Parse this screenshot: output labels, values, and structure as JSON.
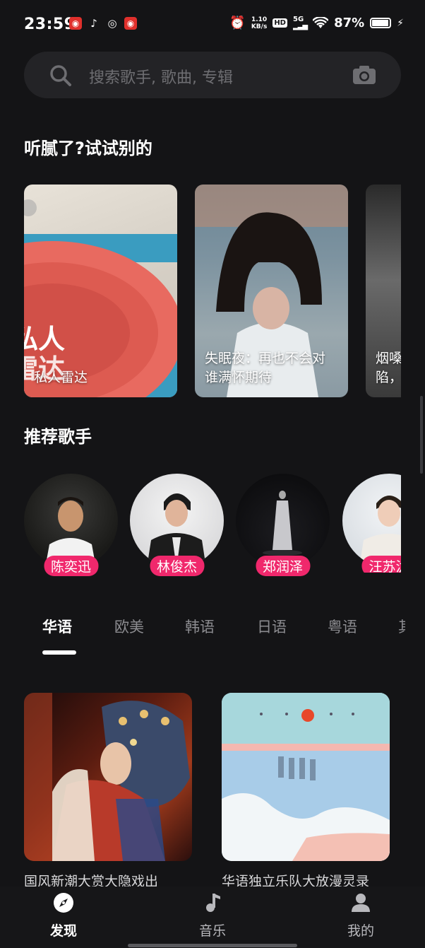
{
  "status_bar": {
    "time": "23:59",
    "net_speed_value": "1.10",
    "net_speed_unit": "KB/s",
    "hd": "HD",
    "network": "5G",
    "battery": "87%",
    "battery_level": 0.87
  },
  "search": {
    "placeholder": "搜索歌手, 歌曲, 专辑"
  },
  "section_try_others": {
    "title": "听腻了?试试别的",
    "cards": [
      {
        "overlay_top": "私人",
        "overlay_bottom": "雷达",
        "caption": "私人雷达"
      },
      {
        "caption": "失眠夜：再也不会对谁满怀期待"
      },
      {
        "caption": "烟嗓 陷，"
      }
    ]
  },
  "section_artists": {
    "title": "推荐歌手",
    "artists": [
      {
        "name": "陈奕迅"
      },
      {
        "name": "林俊杰"
      },
      {
        "name": "郑润泽"
      },
      {
        "name": "汪苏泷"
      }
    ]
  },
  "language_tabs": {
    "tabs": [
      "华语",
      "欧美",
      "韩语",
      "日语",
      "粤语",
      "其"
    ],
    "active": "华语"
  },
  "albums": [
    {
      "title": "国风新潮大赏大隐戏出"
    },
    {
      "title": "华语独立乐队大放漫灵录"
    }
  ],
  "bottom_nav": {
    "items": [
      {
        "label": "发现",
        "icon": "compass-icon",
        "active": true
      },
      {
        "label": "音乐",
        "icon": "music-note-icon",
        "active": false
      },
      {
        "label": "我的",
        "icon": "person-icon",
        "active": false
      }
    ]
  },
  "colors": {
    "background": "#141416",
    "accent_badge": "#f0286c",
    "search_bg": "#232326"
  }
}
